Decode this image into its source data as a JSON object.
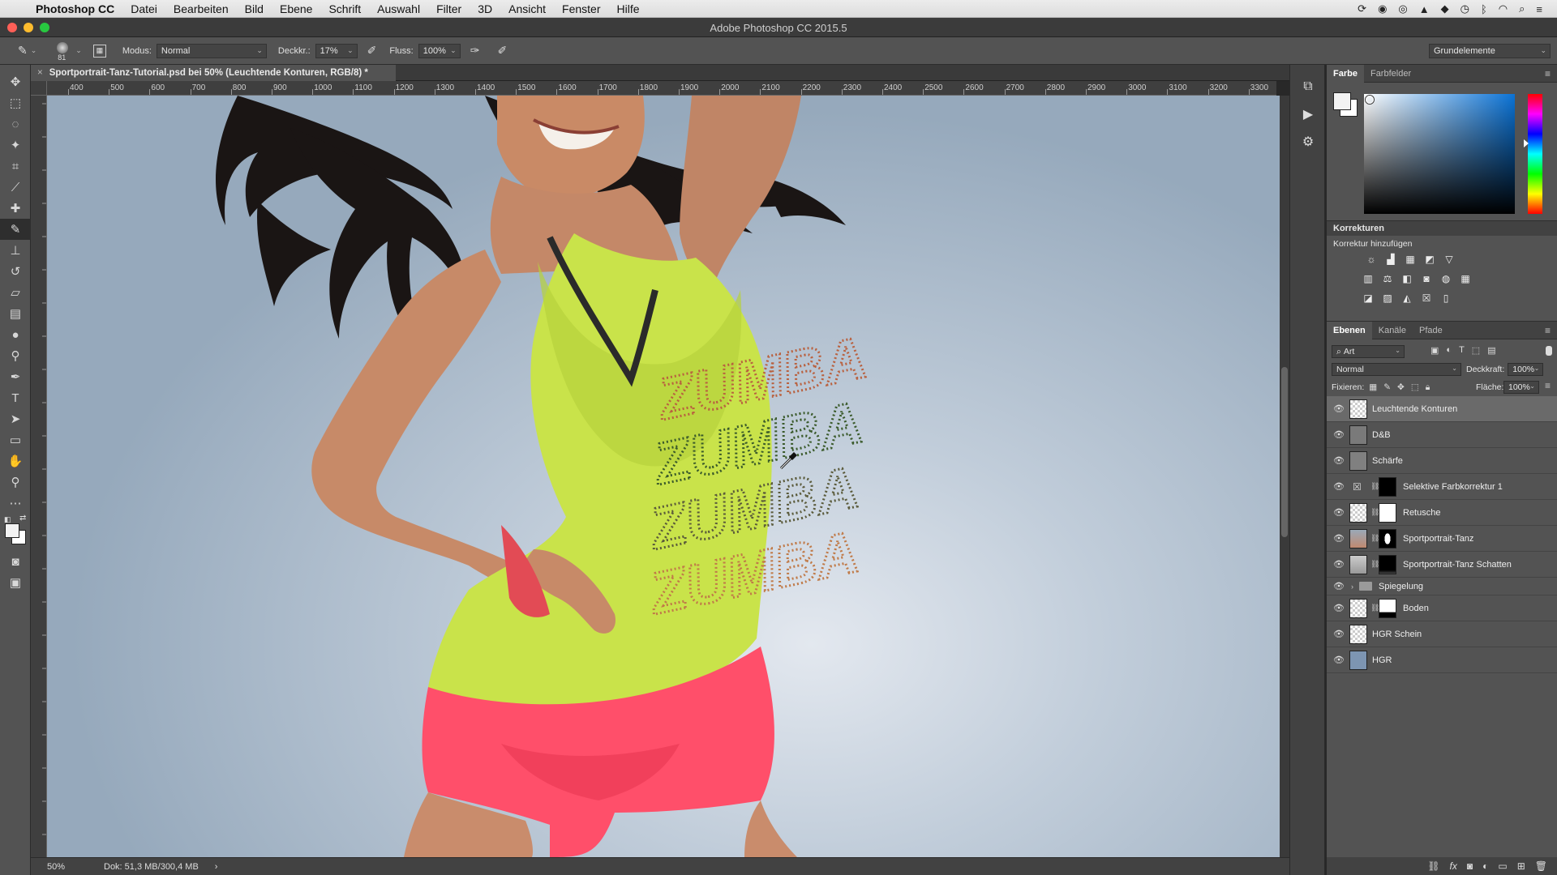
{
  "menubar": {
    "app_name": "Photoshop CC",
    "items": [
      "Datei",
      "Bearbeiten",
      "Bild",
      "Ebene",
      "Schrift",
      "Auswahl",
      "Filter",
      "3D",
      "Ansicht",
      "Fenster",
      "Hilfe"
    ]
  },
  "window": {
    "title": "Adobe Photoshop CC 2015.5"
  },
  "options": {
    "brush_size": "81",
    "modus_label": "Modus:",
    "modus_value": "Normal",
    "deckkr_label": "Deckkr.:",
    "deckkr_value": "17%",
    "fluss_label": "Fluss:",
    "fluss_value": "100%",
    "workspace": "Grundelemente"
  },
  "document": {
    "tab_title": "Sportportrait-Tanz-Tutorial.psd bei 50% (Leuchtende Konturen, RGB/8) *"
  },
  "ruler": {
    "h_ticks": [
      "400",
      "500",
      "600",
      "700",
      "800",
      "900",
      "1000",
      "1100",
      "1200",
      "1300",
      "1400",
      "1500",
      "1600",
      "1700",
      "1800",
      "1900",
      "2000",
      "2100",
      "2200",
      "2300",
      "2400",
      "2500",
      "2600",
      "2700",
      "2800",
      "2900",
      "3000",
      "3100",
      "3200",
      "3300"
    ]
  },
  "shirt_text": [
    "ZUMBA",
    "ZUMBA",
    "ZUMBA",
    "ZUMBA"
  ],
  "status": {
    "zoom": "50%",
    "doc_size": "Dok: 51,3 MB/300,4 MB"
  },
  "color_panel": {
    "tabs": [
      "Farbe",
      "Farbfelder"
    ],
    "fg_color": "#f2f2f2",
    "hue_color": "#0b73d6"
  },
  "korrekturen": {
    "title": "Korrekturen",
    "subtitle": "Korrektur hinzufügen"
  },
  "layers_panel": {
    "tabs": [
      "Ebenen",
      "Kanäle",
      "Pfade"
    ],
    "filter_label": "Art",
    "blend_mode": "Normal",
    "opacity_label": "Deckkraft:",
    "opacity_value": "100%",
    "lock_label": "Fixieren:",
    "fill_label": "Fläche:",
    "fill_value": "100%",
    "layers": [
      {
        "name": "Leuchtende Konturen",
        "selected": true
      },
      {
        "name": "D&B"
      },
      {
        "name": "Schärfe"
      },
      {
        "name": "Selektive Farbkorrektur 1"
      },
      {
        "name": "Retusche"
      },
      {
        "name": "Sportportrait-Tanz"
      },
      {
        "name": "Sportportrait-Tanz Schatten"
      },
      {
        "name": "Spiegelung",
        "group": true
      },
      {
        "name": "Boden"
      },
      {
        "name": "HGR Schein"
      },
      {
        "name": "HGR"
      }
    ]
  }
}
